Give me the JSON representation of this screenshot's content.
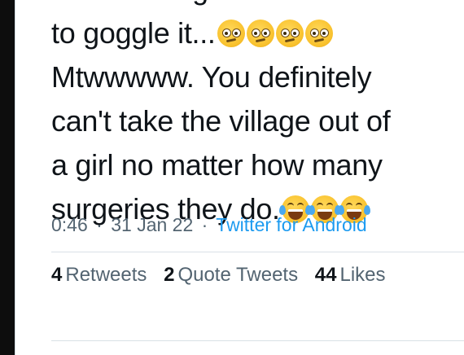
{
  "tweet": {
    "lines": [
      "to goggle it...",
      "Mtwwwww. You definitely",
      "can't take the village out of",
      "a girl no matter how many",
      "surgeries they do."
    ],
    "emoji_confused": "confused-face-emoji",
    "emoji_laugh": "face-with-tears-of-joy-emoji",
    "time": "0:46",
    "date": "31 Jan 22",
    "separator": "·",
    "source": "Twitter for Android"
  },
  "stats": {
    "retweets_count": "4",
    "retweets_label": "Retweets",
    "quotes_count": "2",
    "quotes_label": "Quote Tweets",
    "likes_count": "44",
    "likes_label": "Likes"
  },
  "colors": {
    "text": "#0f1419",
    "secondary": "#536471",
    "link": "#1d9bf0",
    "divider": "#d9e1e6"
  }
}
